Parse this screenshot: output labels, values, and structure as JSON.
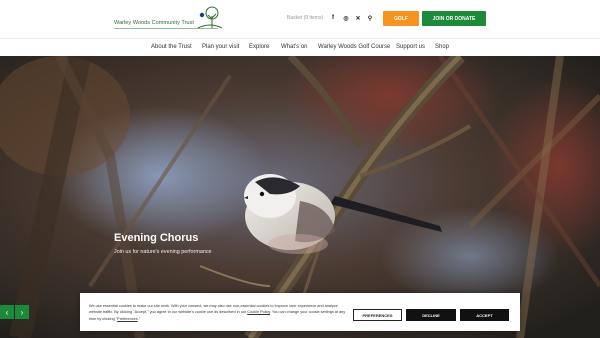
{
  "header": {
    "logo_text": "Warley Woods Community Trust",
    "basket": "Basket (0 items)",
    "social": [
      {
        "icon": "facebook-icon",
        "glyph": "f"
      },
      {
        "icon": "instagram-icon",
        "glyph": "◎"
      },
      {
        "icon": "x-twitter-icon",
        "glyph": "✕"
      },
      {
        "icon": "search-icon",
        "glyph": "⚲"
      }
    ],
    "golf_label": "GOLF",
    "join_label": "JOIN OR DONATE",
    "colors": {
      "golf": "#f7941d",
      "join": "#1d8a3a"
    }
  },
  "nav": {
    "items": [
      "About the Trust",
      "Plan your visit",
      "Explore",
      "What's on",
      "Warley Woods Golf Course",
      "Support us",
      "Shop"
    ]
  },
  "hero": {
    "title": "Evening Chorus",
    "subtitle": "Join us for nature's evening performance",
    "prev_glyph": "‹",
    "next_glyph": "›"
  },
  "cookie": {
    "text_1": "We use essential cookies to make our site work. With your consent, we may also use non-essential cookies to improve user experience and analyze website traffic. By clicking \"Accept,\" you agree to our website's cookie use as described in our ",
    "policy_link": "Cookie Policy",
    "text_2": ". You can change your cookie settings at any time by clicking \"",
    "prefs_link": "Preferences",
    "text_3": ".\"",
    "preferences_label": "PREFERENCES",
    "decline_label": "DECLINE",
    "accept_label": "ACCEPT"
  }
}
